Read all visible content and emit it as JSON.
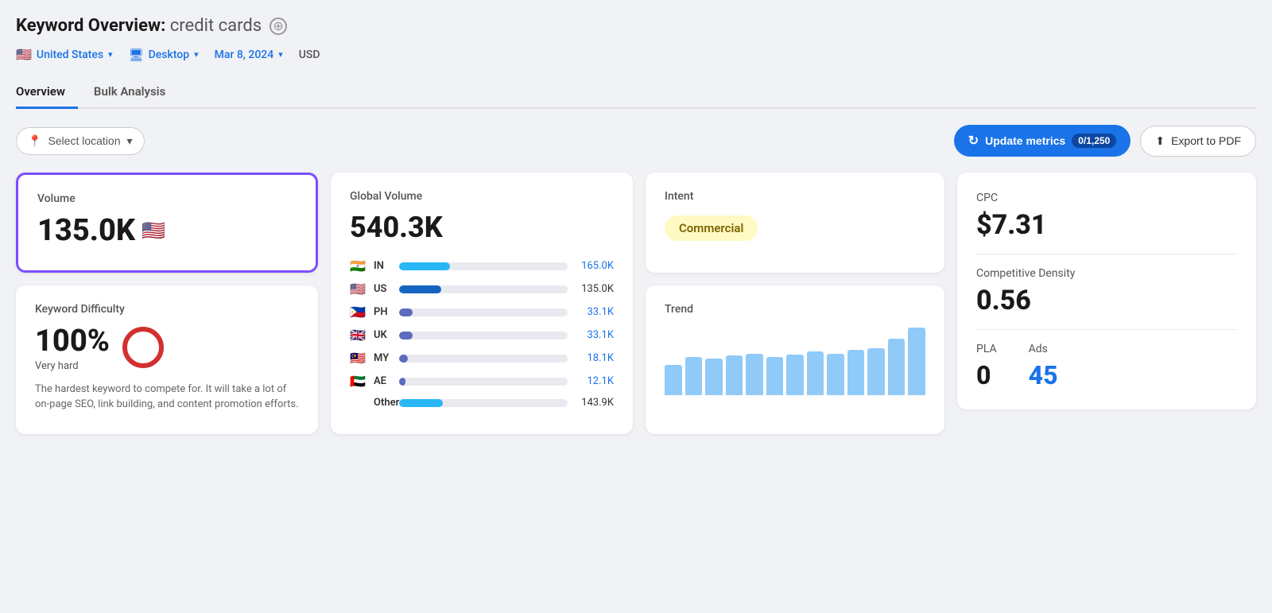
{
  "header": {
    "title_prefix": "Keyword Overview:",
    "keyword": "credit cards",
    "add_icon": "⊕"
  },
  "filters": {
    "location": {
      "flag": "🇺🇸",
      "label": "United States",
      "chevron": "▾"
    },
    "device": {
      "label": "Desktop",
      "chevron": "▾"
    },
    "date": {
      "label": "Mar 8, 2024",
      "chevron": "▾"
    },
    "currency": "USD"
  },
  "tabs": [
    {
      "label": "Overview",
      "active": true
    },
    {
      "label": "Bulk Analysis",
      "active": false
    }
  ],
  "action_bar": {
    "select_location": "Select location",
    "update_metrics": "Update metrics",
    "counter": "0/1,250",
    "export": "Export to PDF"
  },
  "volume_card": {
    "label": "Volume",
    "value": "135.0K",
    "flag": "🇺🇸"
  },
  "kd_card": {
    "label": "Keyword Difficulty",
    "value": "100%",
    "sub": "Very hard",
    "description": "The hardest keyword to compete for. It will take a lot of on-page SEO, link building, and content promotion efforts."
  },
  "global_volume_card": {
    "label": "Global Volume",
    "value": "540.3K",
    "countries": [
      {
        "flag": "🇮🇳",
        "code": "IN",
        "value": "165.0K",
        "bar_pct": 30,
        "color": "#29b6f6",
        "text_color": "blue"
      },
      {
        "flag": "🇺🇸",
        "code": "US",
        "value": "135.0K",
        "bar_pct": 25,
        "color": "#1565c0",
        "text_color": "black"
      },
      {
        "flag": "🇵🇭",
        "code": "PH",
        "value": "33.1K",
        "bar_pct": 8,
        "color": "#5c6bc0",
        "text_color": "blue"
      },
      {
        "flag": "🇬🇧",
        "code": "UK",
        "value": "33.1K",
        "bar_pct": 8,
        "color": "#5c6bc0",
        "text_color": "blue"
      },
      {
        "flag": "🇲🇾",
        "code": "MY",
        "value": "18.1K",
        "bar_pct": 5,
        "color": "#5c6bc0",
        "text_color": "blue"
      },
      {
        "flag": "🇦🇪",
        "code": "AE",
        "value": "12.1K",
        "bar_pct": 4,
        "color": "#5c6bc0",
        "text_color": "blue"
      }
    ],
    "other_label": "Other",
    "other_value": "143.9K",
    "other_bar_pct": 26,
    "other_color": "#29b6f6"
  },
  "intent_card": {
    "label": "Intent",
    "badge": "Commercial"
  },
  "trend_card": {
    "label": "Trend",
    "bars": [
      40,
      50,
      48,
      52,
      55,
      50,
      53,
      58,
      55,
      60,
      62,
      75,
      90
    ]
  },
  "cpc_value": "$7.31",
  "competitive_density": "0.56",
  "pla_value": "0",
  "ads_value": "45"
}
